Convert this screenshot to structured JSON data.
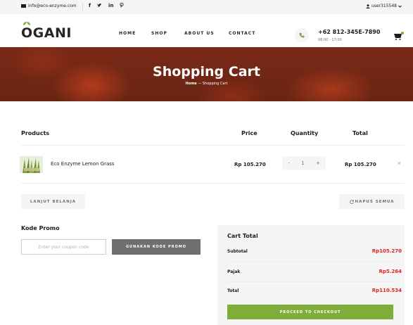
{
  "topbar": {
    "email": "info@eco-enzyme.com",
    "social": [
      "f",
      "𝕪",
      "in",
      "℗"
    ],
    "user": "user315548"
  },
  "header": {
    "logo": "OGANI",
    "nav": [
      "HOME",
      "SHOP",
      "ABOUT US",
      "CONTACT"
    ],
    "phone": "+62 812-345E-7890",
    "hours": "08:00 - 17:00"
  },
  "hero": {
    "title": "Shopping Cart",
    "crumb_home": "Home",
    "crumb_sep": " — ",
    "crumb_current": "Shopping Cart"
  },
  "table": {
    "headers": [
      "Products",
      "Price",
      "Quantity",
      "Total"
    ],
    "rows": [
      {
        "name": "Eco Enzyme Lemon Grass",
        "price": "Rp 105.270",
        "qty": "1",
        "total": "Rp 105.270"
      }
    ]
  },
  "actions": {
    "continue_label": "LANJUT BELANJA",
    "clear_label": "HAPUS SEMUA"
  },
  "promo": {
    "title": "Kode Promo",
    "placeholder": "Enter your coupon code",
    "apply_label": "GUNAKAN KODE PROMO"
  },
  "cart_total": {
    "title": "Cart Total",
    "rows": [
      {
        "label": "Subtotal",
        "value": "Rp105.270"
      },
      {
        "label": "Pajak",
        "value": "Rp5.264"
      },
      {
        "label": "Total",
        "value": "Rp110.534"
      }
    ],
    "checkout_label": "PROCEED TO CHECKOUT"
  },
  "colors": {
    "accent": "#7fad39",
    "price_red": "#dd2222",
    "muted": "#6f6f6f",
    "panel": "#f5f5f5"
  },
  "icons": [
    "envelope-icon",
    "facebook-icon",
    "twitter-icon",
    "linkedin-icon",
    "pinterest-icon",
    "user-icon",
    "chevron-down-icon",
    "phone-icon",
    "cart-icon",
    "close-icon",
    "refresh-icon"
  ]
}
